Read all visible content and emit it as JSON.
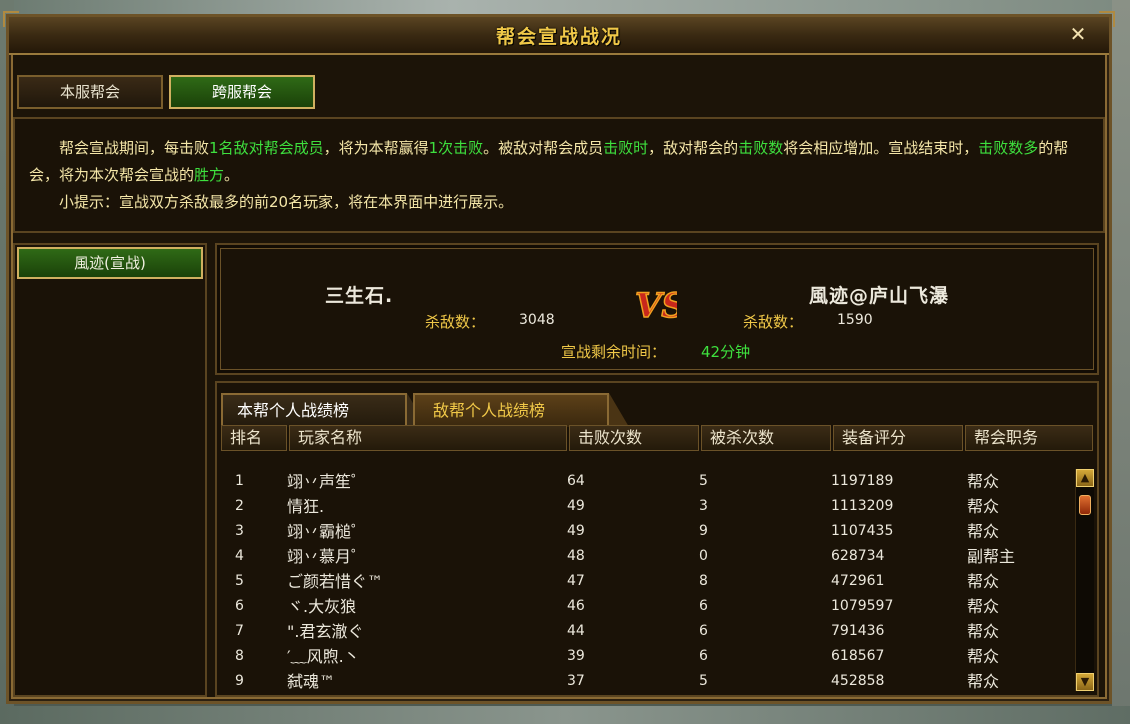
{
  "window": {
    "title": "帮会宣战战况",
    "close_symbol": "✕"
  },
  "tabs": {
    "local": "本服帮会",
    "cross": "跨服帮会"
  },
  "description": {
    "p1": [
      {
        "t": "帮会宣战期间，每击败",
        "g": false
      },
      {
        "t": "1名",
        "g": true
      },
      {
        "t": "敌对帮会成员",
        "g": true
      },
      {
        "t": "，将为本帮赢得",
        "g": false
      },
      {
        "t": "1次击败",
        "g": true
      },
      {
        "t": "。被敌对帮会成员",
        "g": false
      },
      {
        "t": "击败时",
        "g": true
      },
      {
        "t": "，敌对帮会的",
        "g": false
      },
      {
        "t": "击败数",
        "g": true
      },
      {
        "t": "将会相应增加。宣战结束时，",
        "g": false
      },
      {
        "t": "击败数多",
        "g": true
      },
      {
        "t": "的帮会，将为本次帮会宣战的",
        "g": false
      },
      {
        "t": "胜方",
        "g": true
      },
      {
        "t": "。",
        "g": false
      }
    ],
    "tip": "小提示：宣战双方杀敌最多的前20名玩家，将在本界面中进行展示。"
  },
  "left_panel": {
    "guild_button": "風迹(宣战)"
  },
  "battle": {
    "left_guild": "三生石.",
    "right_guild": "風迹@庐山飞瀑",
    "kill_label": "杀敌数：",
    "left_kills": "3048",
    "right_kills": "1590",
    "vs": "VS",
    "time_label": "宣战剩余时间：",
    "time_value": "42分钟"
  },
  "subtabs": {
    "own": "本帮个人战绩榜",
    "enemy": "敌帮个人战绩榜"
  },
  "table": {
    "headers": [
      "排名",
      "玩家名称",
      "击败次数",
      "被杀次数",
      "装备评分",
      "帮会职务"
    ],
    "rows": [
      [
        "1",
        "翊丷声笙゜",
        "64",
        "5",
        "1197189",
        "帮众"
      ],
      [
        "2",
        "情狂.",
        "49",
        "3",
        "1113209",
        "帮众"
      ],
      [
        "3",
        "翊丷霸槌゜",
        "49",
        "9",
        "1107435",
        "帮众"
      ],
      [
        "4",
        "翊丷慕月゜",
        "48",
        "0",
        "628734",
        "副帮主"
      ],
      [
        "5",
        "ご颜若惜ぐ™",
        "47",
        "8",
        "472961",
        "帮众"
      ],
      [
        "6",
        "ヾ.大灰狼",
        "46",
        "6",
        "1079597",
        "帮众"
      ],
      [
        "7",
        "\".君玄澈ぐ",
        "44",
        "6",
        "791436",
        "帮众"
      ],
      [
        "8",
        "′﹏风煦.丶",
        "39",
        "6",
        "618567",
        "帮众"
      ],
      [
        "9",
        "弑魂™",
        "37",
        "5",
        "452858",
        "帮众"
      ]
    ]
  },
  "scrollbar": {
    "up": "▲",
    "down": "▼"
  },
  "colors": {
    "accent_gold": "#f0c848",
    "highlight_green": "#3ee03e",
    "panel_bg": "#1a1207"
  }
}
